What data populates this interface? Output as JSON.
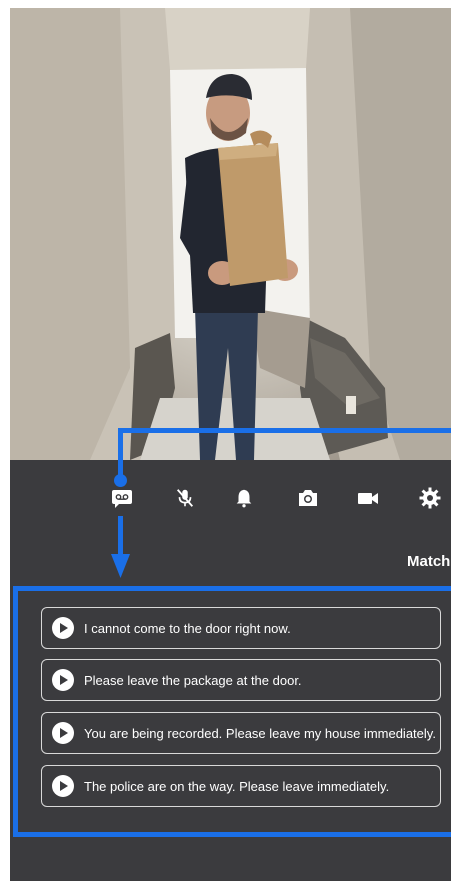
{
  "toolbar": {
    "icons": [
      "voicemail-icon",
      "mic-off-icon",
      "bell-icon",
      "camera-icon",
      "video-icon",
      "settings-icon"
    ],
    "match_label": "Match"
  },
  "quick_replies": [
    {
      "text": "I cannot come to the door right now."
    },
    {
      "text": "Please leave the package at the door."
    },
    {
      "text": "You are being recorded. Please leave my house immediately."
    },
    {
      "text": "The police are on the way. Please leave immediately."
    }
  ],
  "colors": {
    "annotation": "#1a6fe8",
    "panel_bg": "#3b3b3e"
  }
}
